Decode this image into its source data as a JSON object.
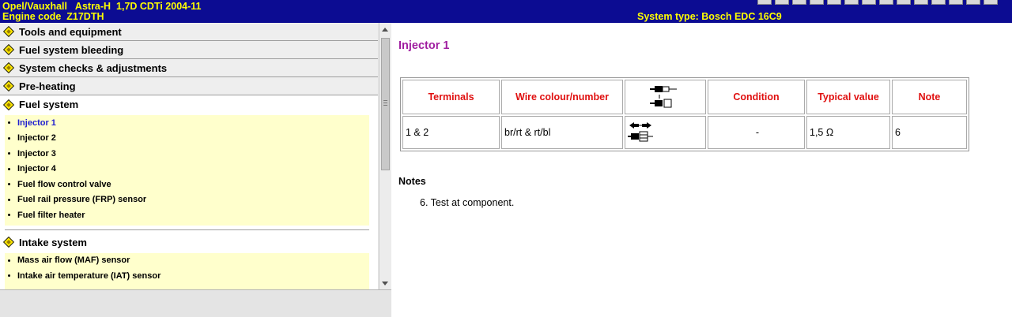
{
  "header": {
    "vehicle": "Opel/Vauxhall   Astra-H  1,7D CDTi 2004-11",
    "engine_code": "Engine code  Z17DTH",
    "system_type": "System type: Bosch EDC 16C9"
  },
  "colors": {
    "header_bg": "#0c0c92",
    "header_text": "#ffff00",
    "title": "#a01ea0",
    "table_header": "#e01010",
    "active_link": "#2020d0",
    "sublist_bg": "#ffffcc"
  },
  "sidebar": {
    "categories": [
      {
        "label": "Tools and equipment"
      },
      {
        "label": "Fuel system bleeding"
      },
      {
        "label": "System checks & adjustments"
      },
      {
        "label": "Pre-heating"
      }
    ],
    "fuel_system": {
      "label": "Fuel system",
      "items": [
        {
          "label": "Injector 1"
        },
        {
          "label": "Injector 2"
        },
        {
          "label": "Injector 3"
        },
        {
          "label": "Injector 4"
        },
        {
          "label": "Fuel flow control valve"
        },
        {
          "label": "Fuel rail pressure (FRP) sensor"
        },
        {
          "label": "Fuel filter heater"
        }
      ]
    },
    "intake_system": {
      "label": "Intake system",
      "items": [
        {
          "label": "Mass air flow (MAF) sensor"
        },
        {
          "label": "Intake air temperature (IAT) sensor"
        }
      ]
    }
  },
  "main": {
    "title": "Injector 1",
    "table": {
      "headers": [
        "Terminals",
        "Wire colour/number",
        "Condition",
        "Typical value",
        "Note"
      ],
      "header_icon": "connector-harness-icon",
      "row_icon": "connector-disconnected-icon",
      "rows": [
        {
          "terminals": "1 & 2",
          "wire": "br/rt & rt/bl",
          "condition": "-",
          "value": "1,5 Ω",
          "note": "6"
        }
      ]
    },
    "notes_heading": "Notes",
    "notes": [
      "6. Test at component."
    ]
  }
}
